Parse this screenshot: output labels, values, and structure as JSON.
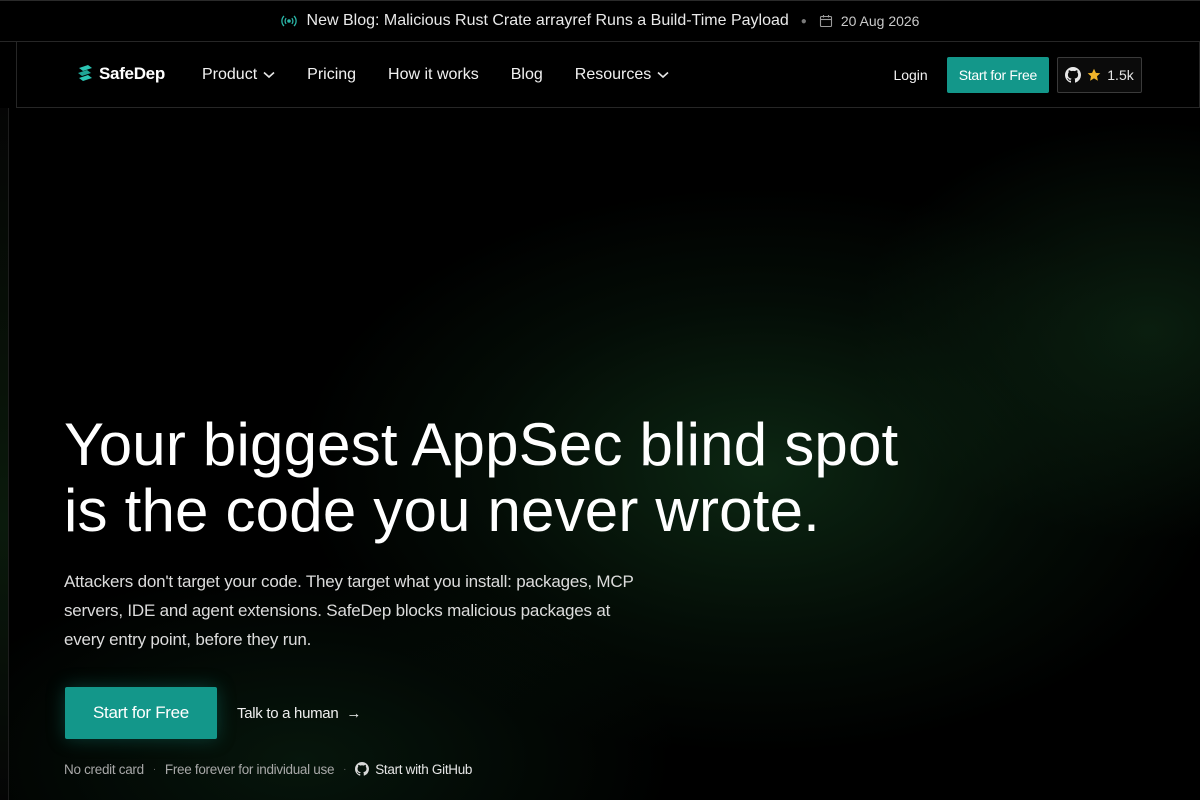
{
  "announcement": {
    "text": "New Blog: Malicious Rust Crate arrayref Runs a Build-Time Payload",
    "date": "20 Aug 2026"
  },
  "nav": {
    "logo_text": "SafeDep",
    "items": [
      {
        "label": "Product",
        "dropdown": true
      },
      {
        "label": "Pricing",
        "dropdown": false
      },
      {
        "label": "How it works",
        "dropdown": false
      },
      {
        "label": "Blog",
        "dropdown": false
      },
      {
        "label": "Resources",
        "dropdown": true
      }
    ],
    "login_label": "Login",
    "cta_label": "Start for Free",
    "github_stars": "1.5k"
  },
  "hero": {
    "title_line1": "Your biggest AppSec blind spot",
    "title_line2": "is the code you never wrote.",
    "subtitle": "Attackers don't target your code. They target what you install: packages, MCP servers, IDE and agent extensions. SafeDep blocks malicious packages at every entry point, before they run.",
    "primary_cta": "Start for Free",
    "secondary_cta": "Talk to a human",
    "secondary_arrow": "→",
    "notes": [
      "No credit card",
      "Free forever for individual use"
    ],
    "github_note": "Start with GitHub"
  },
  "colors": {
    "accent": "#13978a",
    "background": "#000000",
    "glow": "#164622"
  }
}
